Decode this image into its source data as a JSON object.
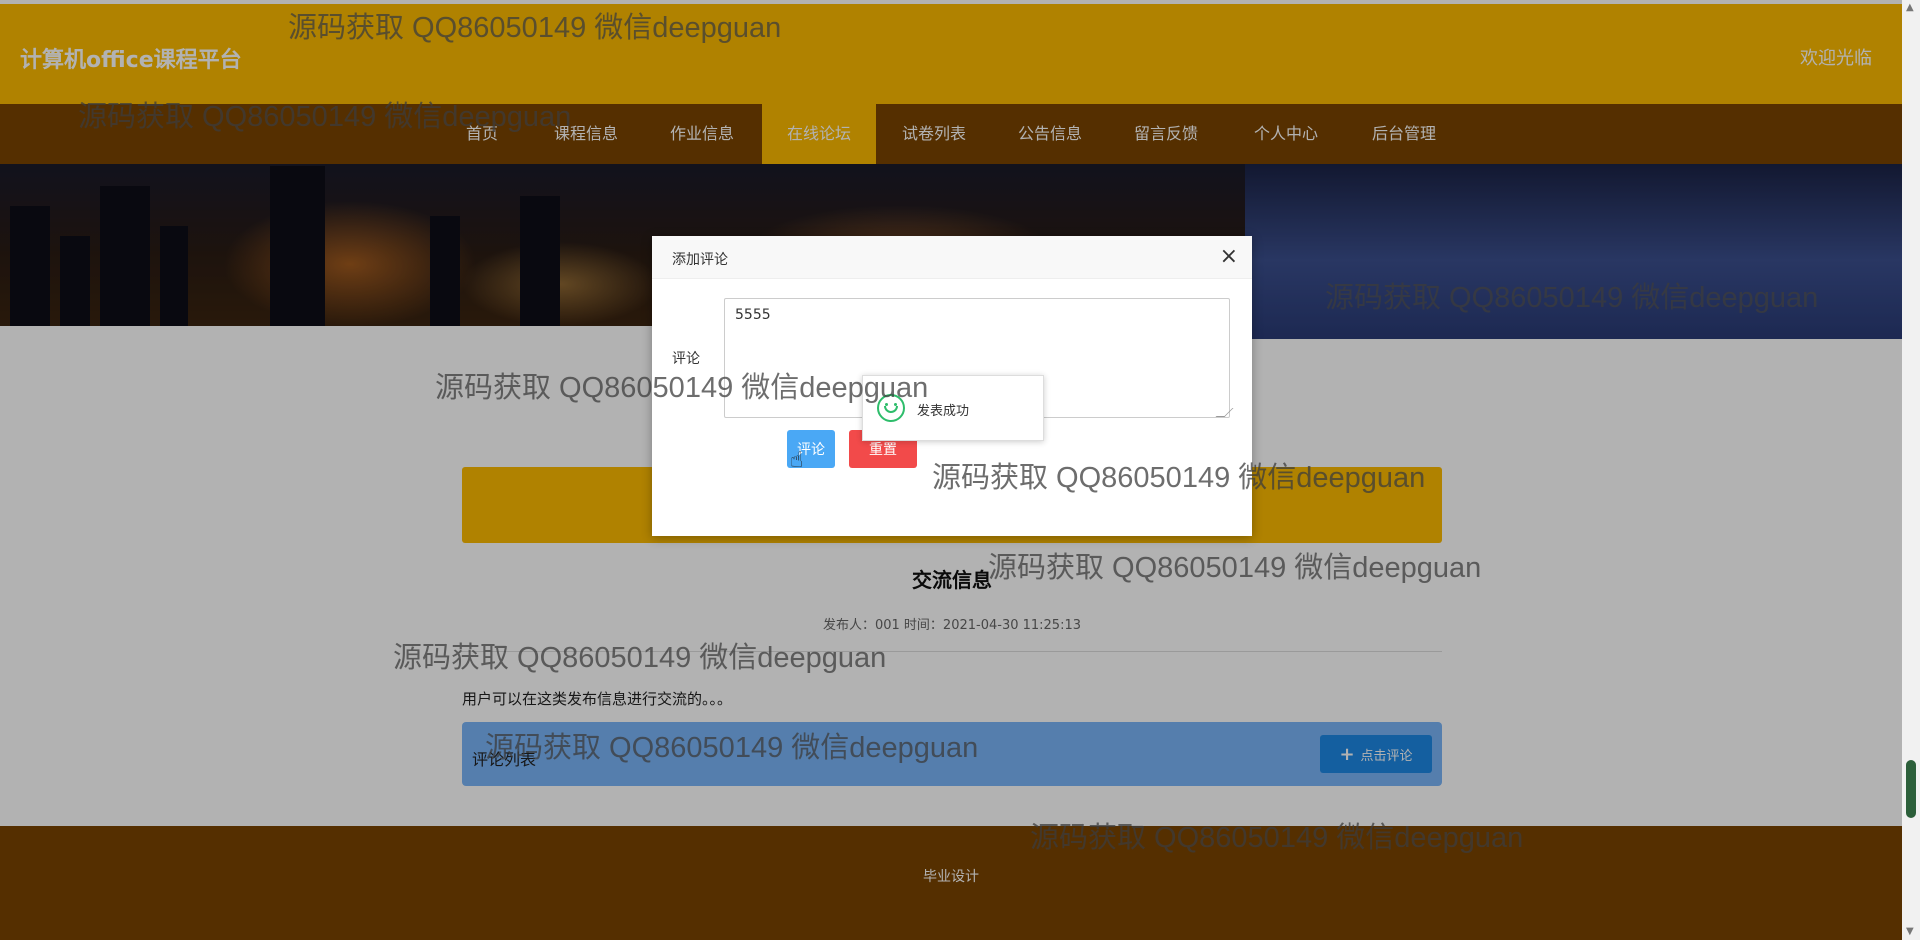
{
  "header": {
    "site_title": "计算机office课程平台",
    "welcome": "欢迎光临"
  },
  "nav": {
    "items": [
      {
        "label": "首页"
      },
      {
        "label": "课程信息"
      },
      {
        "label": "作业信息"
      },
      {
        "label": "在线论坛",
        "active": true
      },
      {
        "label": "试卷列表"
      },
      {
        "label": "公告信息"
      },
      {
        "label": "留言反馈"
      },
      {
        "label": "个人中心"
      },
      {
        "label": "后台管理"
      }
    ]
  },
  "post": {
    "title": "交流信息",
    "meta": "发布人：001 时间：2021-04-30 11:25:13",
    "body": "用户可以在这类发布信息进行交流的。。。",
    "comment_list_label": "评论列表",
    "add_comment_label": "点击评论"
  },
  "footer": {
    "text": "毕业设计"
  },
  "modal": {
    "title": "添加评论",
    "field_label": "评论",
    "comment_value": "5555",
    "submit_label": "评论",
    "reset_label": "重置"
  },
  "toast": {
    "message": "发表成功"
  },
  "watermark": {
    "text": "源码获取 QQ86050149 微信deepguan"
  },
  "colors": {
    "header": "#fdbb00",
    "nav": "#7a4400",
    "submit": "#4aa8f5",
    "reset": "#f24a4a",
    "comment_panel": "#7ab5f8"
  }
}
